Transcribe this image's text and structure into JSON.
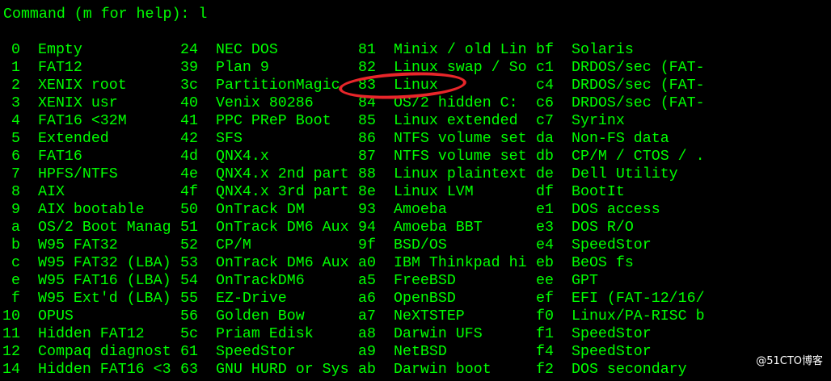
{
  "terminal": {
    "prompt": "Command (m for help): l",
    "colors": {
      "background": "#000000",
      "text": "#00ff00",
      "highlight": "#e8262a",
      "watermark": "#ffffff"
    },
    "partition_types": [
      [
        {
          "code": "0",
          "name": "Empty"
        },
        {
          "code": "24",
          "name": "NEC DOS"
        },
        {
          "code": "81",
          "name": "Minix / old Lin"
        },
        {
          "code": "bf",
          "name": "Solaris"
        }
      ],
      [
        {
          "code": "1",
          "name": "FAT12"
        },
        {
          "code": "39",
          "name": "Plan 9"
        },
        {
          "code": "82",
          "name": "Linux swap / So"
        },
        {
          "code": "c1",
          "name": "DRDOS/sec (FAT-"
        }
      ],
      [
        {
          "code": "2",
          "name": "XENIX root"
        },
        {
          "code": "3c",
          "name": "PartitionMagic"
        },
        {
          "code": "83",
          "name": "Linux"
        },
        {
          "code": "c4",
          "name": "DRDOS/sec (FAT-"
        }
      ],
      [
        {
          "code": "3",
          "name": "XENIX usr"
        },
        {
          "code": "40",
          "name": "Venix 80286"
        },
        {
          "code": "84",
          "name": "OS/2 hidden C:"
        },
        {
          "code": "c6",
          "name": "DRDOS/sec (FAT-"
        }
      ],
      [
        {
          "code": "4",
          "name": "FAT16 <32M"
        },
        {
          "code": "41",
          "name": "PPC PReP Boot"
        },
        {
          "code": "85",
          "name": "Linux extended"
        },
        {
          "code": "c7",
          "name": "Syrinx"
        }
      ],
      [
        {
          "code": "5",
          "name": "Extended"
        },
        {
          "code": "42",
          "name": "SFS"
        },
        {
          "code": "86",
          "name": "NTFS volume set"
        },
        {
          "code": "da",
          "name": "Non-FS data"
        }
      ],
      [
        {
          "code": "6",
          "name": "FAT16"
        },
        {
          "code": "4d",
          "name": "QNX4.x"
        },
        {
          "code": "87",
          "name": "NTFS volume set"
        },
        {
          "code": "db",
          "name": "CP/M / CTOS / ."
        }
      ],
      [
        {
          "code": "7",
          "name": "HPFS/NTFS"
        },
        {
          "code": "4e",
          "name": "QNX4.x 2nd part"
        },
        {
          "code": "88",
          "name": "Linux plaintext"
        },
        {
          "code": "de",
          "name": "Dell Utility"
        }
      ],
      [
        {
          "code": "8",
          "name": "AIX"
        },
        {
          "code": "4f",
          "name": "QNX4.x 3rd part"
        },
        {
          "code": "8e",
          "name": "Linux LVM"
        },
        {
          "code": "df",
          "name": "BootIt"
        }
      ],
      [
        {
          "code": "9",
          "name": "AIX bootable"
        },
        {
          "code": "50",
          "name": "OnTrack DM"
        },
        {
          "code": "93",
          "name": "Amoeba"
        },
        {
          "code": "e1",
          "name": "DOS access"
        }
      ],
      [
        {
          "code": "a",
          "name": "OS/2 Boot Manag"
        },
        {
          "code": "51",
          "name": "OnTrack DM6 Aux"
        },
        {
          "code": "94",
          "name": "Amoeba BBT"
        },
        {
          "code": "e3",
          "name": "DOS R/O"
        }
      ],
      [
        {
          "code": "b",
          "name": "W95 FAT32"
        },
        {
          "code": "52",
          "name": "CP/M"
        },
        {
          "code": "9f",
          "name": "BSD/OS"
        },
        {
          "code": "e4",
          "name": "SpeedStor"
        }
      ],
      [
        {
          "code": "c",
          "name": "W95 FAT32 (LBA)"
        },
        {
          "code": "53",
          "name": "OnTrack DM6 Aux"
        },
        {
          "code": "a0",
          "name": "IBM Thinkpad hi"
        },
        {
          "code": "eb",
          "name": "BeOS fs"
        }
      ],
      [
        {
          "code": "e",
          "name": "W95 FAT16 (LBA)"
        },
        {
          "code": "54",
          "name": "OnTrackDM6"
        },
        {
          "code": "a5",
          "name": "FreeBSD"
        },
        {
          "code": "ee",
          "name": "GPT"
        }
      ],
      [
        {
          "code": "f",
          "name": "W95 Ext'd (LBA)"
        },
        {
          "code": "55",
          "name": "EZ-Drive"
        },
        {
          "code": "a6",
          "name": "OpenBSD"
        },
        {
          "code": "ef",
          "name": "EFI (FAT-12/16/"
        }
      ],
      [
        {
          "code": "10",
          "name": "OPUS"
        },
        {
          "code": "56",
          "name": "Golden Bow"
        },
        {
          "code": "a7",
          "name": "NeXTSTEP"
        },
        {
          "code": "f0",
          "name": "Linux/PA-RISC b"
        }
      ],
      [
        {
          "code": "11",
          "name": "Hidden FAT12"
        },
        {
          "code": "5c",
          "name": "Priam Edisk"
        },
        {
          "code": "a8",
          "name": "Darwin UFS"
        },
        {
          "code": "f1",
          "name": "SpeedStor"
        }
      ],
      [
        {
          "code": "12",
          "name": "Compaq diagnost"
        },
        {
          "code": "61",
          "name": "SpeedStor"
        },
        {
          "code": "a9",
          "name": "NetBSD"
        },
        {
          "code": "f4",
          "name": "SpeedStor"
        }
      ],
      [
        {
          "code": "14",
          "name": "Hidden FAT16 <3"
        },
        {
          "code": "63",
          "name": "GNU HURD or Sys"
        },
        {
          "code": "ab",
          "name": "Darwin boot"
        },
        {
          "code": "f2",
          "name": "DOS secondary"
        }
      ]
    ]
  },
  "watermark": "@51CTO博客"
}
